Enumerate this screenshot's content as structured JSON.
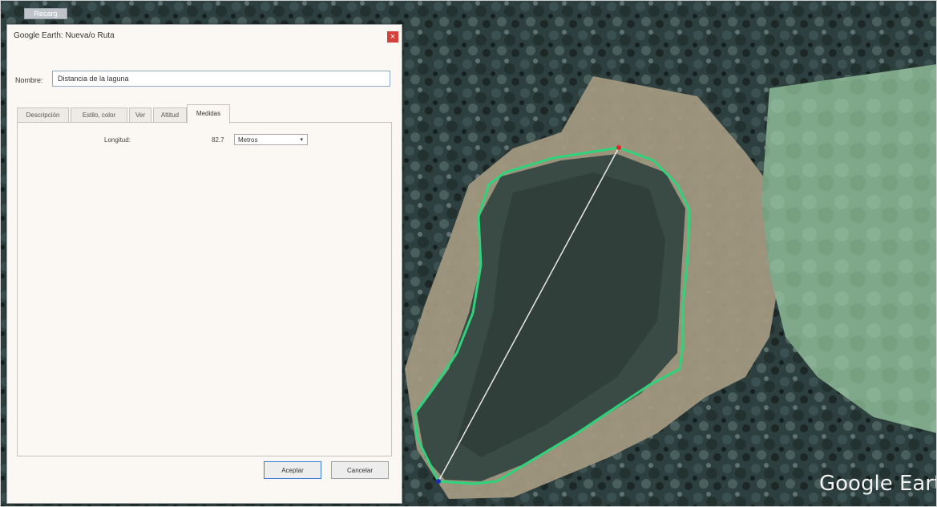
{
  "app": {
    "top_button": "Recarg"
  },
  "dialog": {
    "title": "Google Earth: Nueva/o Ruta",
    "close_label": "×",
    "name_label": "Nombre:",
    "name_value": "Distancia de la laguna",
    "tabs": [
      {
        "label": "Descripción"
      },
      {
        "label": "Estilo, color"
      },
      {
        "label": "Ver"
      },
      {
        "label": "Altitud"
      },
      {
        "label": "Medidas"
      }
    ],
    "active_tab": "Medidas",
    "measure": {
      "length_label": "Longitud:",
      "length_value": "82.7",
      "unit_value": "Metros",
      "arrow": "▾"
    },
    "buttons": {
      "accept": "Aceptar",
      "cancel": "Cancelar"
    }
  },
  "map": {
    "watermark": "Google Earth",
    "path_color": "#2fd37b",
    "line_color": "#e8e8e8"
  }
}
